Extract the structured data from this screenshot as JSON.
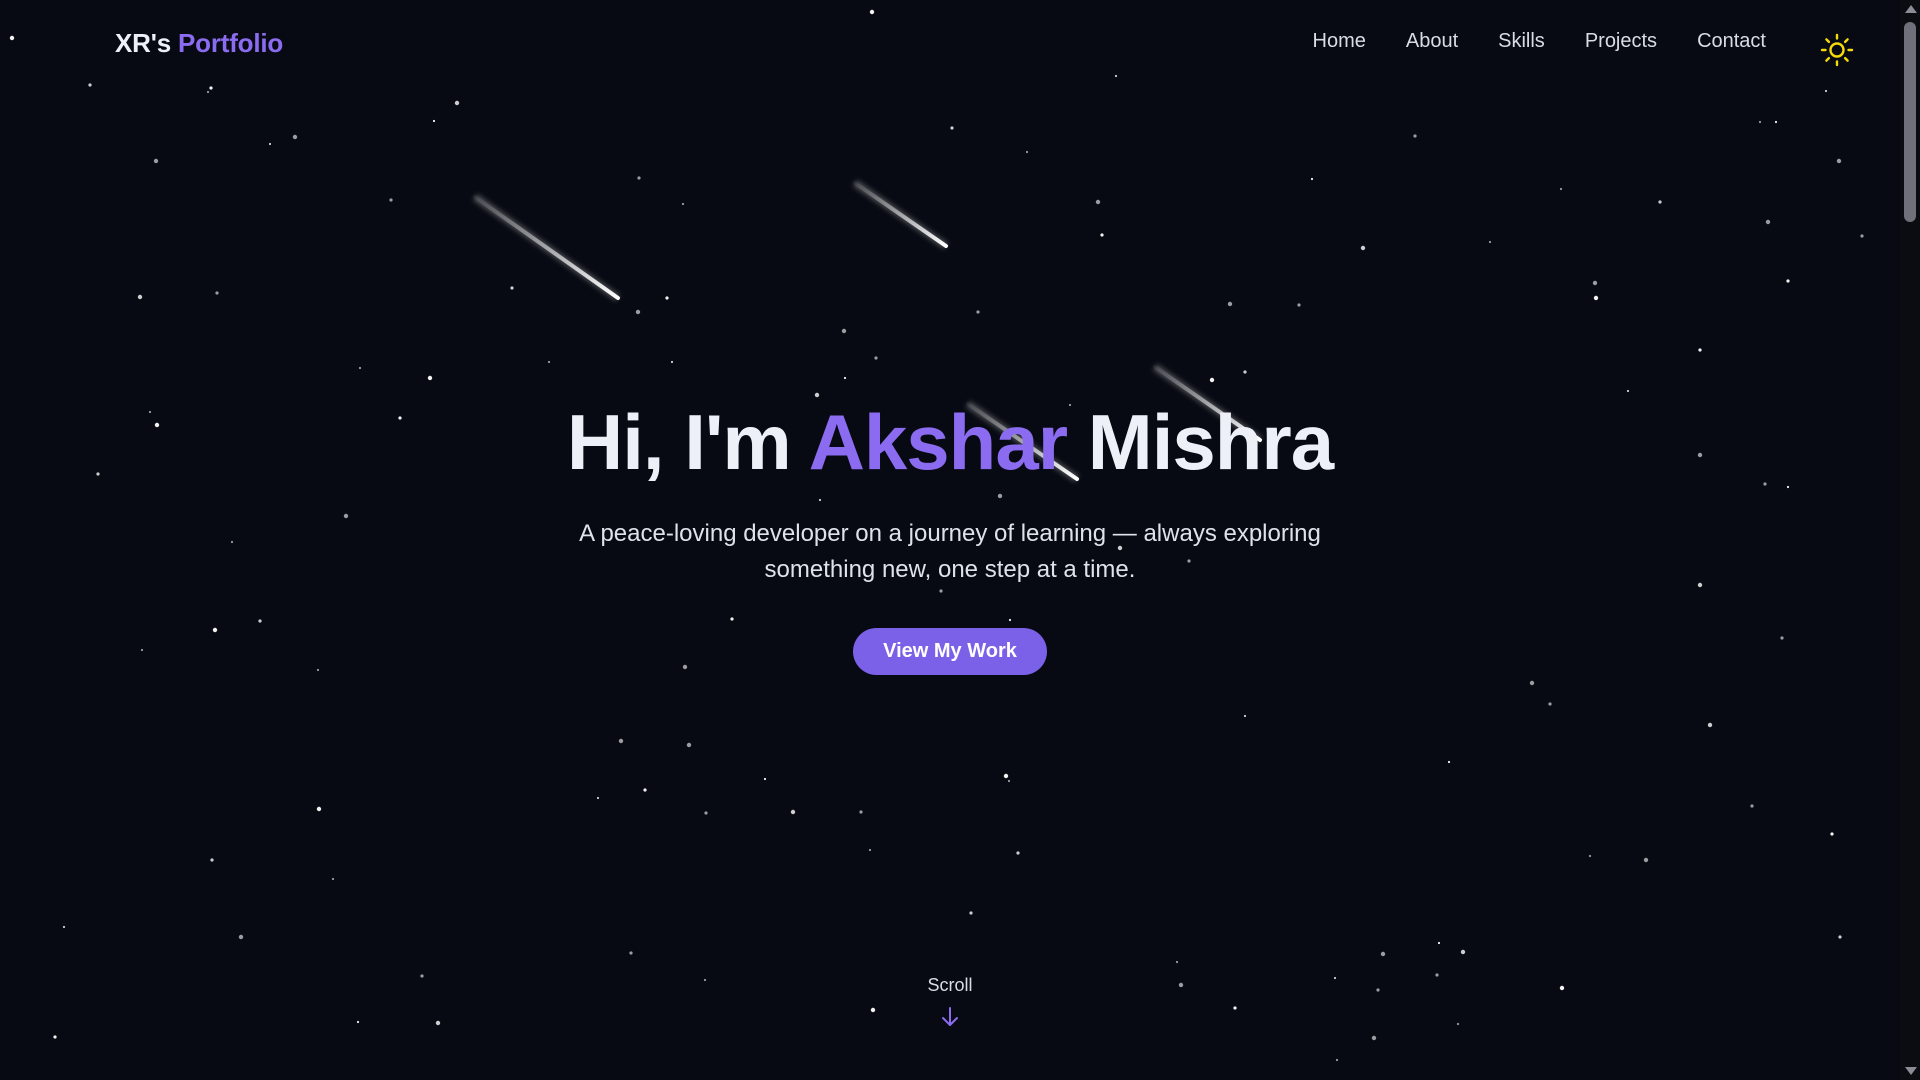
{
  "nav": {
    "logo_prefix": "XR's",
    "logo_accent": "Portfolio",
    "links": [
      "Home",
      "About",
      "Skills",
      "Projects",
      "Contact"
    ],
    "theme_toggle_icon": "sun-icon"
  },
  "hero": {
    "greeting": "Hi, I'm",
    "first_name": "Akshar",
    "last_name": "Mishra",
    "subtitle": "A peace-loving developer on a journey of learning — always exploring something new, one step at a time.",
    "cta_label": "View My Work"
  },
  "scroll_hint": {
    "label": "Scroll",
    "icon": "arrow-down-icon"
  },
  "colors": {
    "background": "#070a12",
    "accent": "#8b6cf0",
    "button": "#7b61e8",
    "sun": "#f5d90a",
    "text": "#eef0f8"
  }
}
